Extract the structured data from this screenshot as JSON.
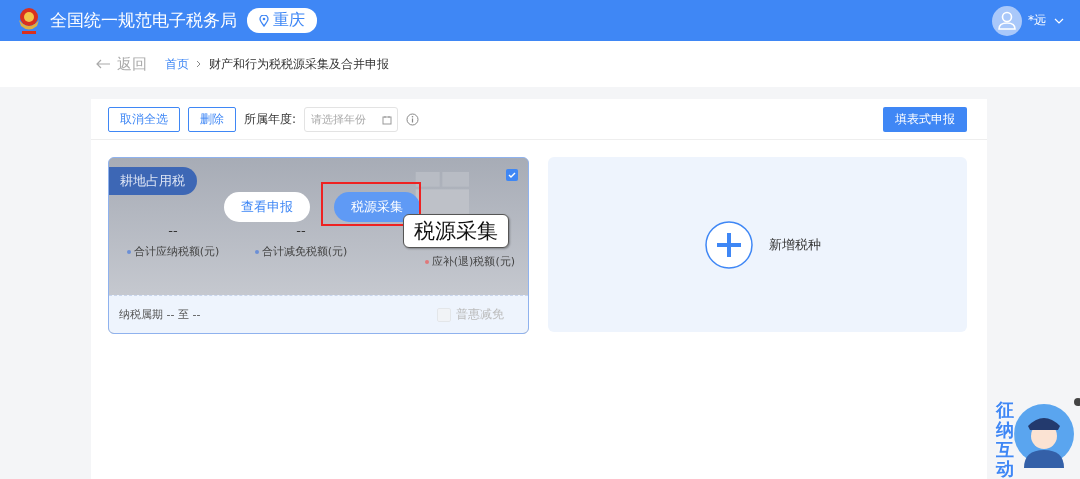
{
  "header": {
    "title": "全国统一规范电子税务局",
    "region": "重庆",
    "user": "*远"
  },
  "nav": {
    "back": "返回",
    "breadcrumb": [
      {
        "label": "首页",
        "kind": "link"
      },
      {
        "label": "财产和行为税税源采集及合并申报",
        "kind": "current"
      }
    ]
  },
  "toolbar": {
    "buttons": [
      "取消全选",
      "删除"
    ],
    "year_label": "所属年度:",
    "year_placeholder": "请选择年份",
    "submit": "填表式申报"
  },
  "tax_card": {
    "name": "耕地占用税",
    "checked": true,
    "actions": [
      "查看申报",
      "税源采集"
    ],
    "stats": [
      {
        "value": "--",
        "label": "合计应纳税额(元)",
        "color": "#6b8fd6"
      },
      {
        "value": "--",
        "label": "合计减免税额(元)",
        "color": "#6b8fd6"
      },
      {
        "label": "应补(退)税额(元)",
        "color": "#e0787a"
      }
    ],
    "period": "纳税属期 -- 至 --",
    "relief": {
      "label": "普惠减免",
      "checked": false,
      "disabled": true
    }
  },
  "callout": "税源采集",
  "add_card": {
    "label": "新增税种"
  },
  "assistant": {
    "label": "征纳互动"
  }
}
